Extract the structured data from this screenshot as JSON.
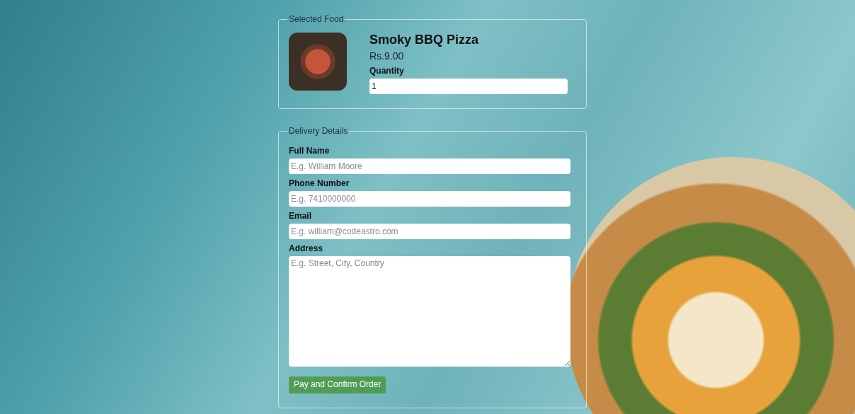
{
  "selected_food": {
    "legend": "Selected Food",
    "name": "Smoky BBQ Pizza",
    "price": "Rs.9.00",
    "quantity_label": "Quantity",
    "quantity_value": "1"
  },
  "delivery": {
    "legend": "Delivery Details",
    "fields": [
      {
        "kind": "input",
        "label": "Full Name",
        "placeholder": "E.g. William Moore"
      },
      {
        "kind": "input",
        "label": "Phone Number",
        "placeholder": "E.g. 7410000000"
      },
      {
        "kind": "input",
        "label": "Email",
        "placeholder": "E.g. william@codeastro.com"
      },
      {
        "kind": "textarea",
        "label": "Address",
        "placeholder": "E.g. Street, City, Country"
      }
    ]
  },
  "submit_button": "Pay and Confirm Order"
}
